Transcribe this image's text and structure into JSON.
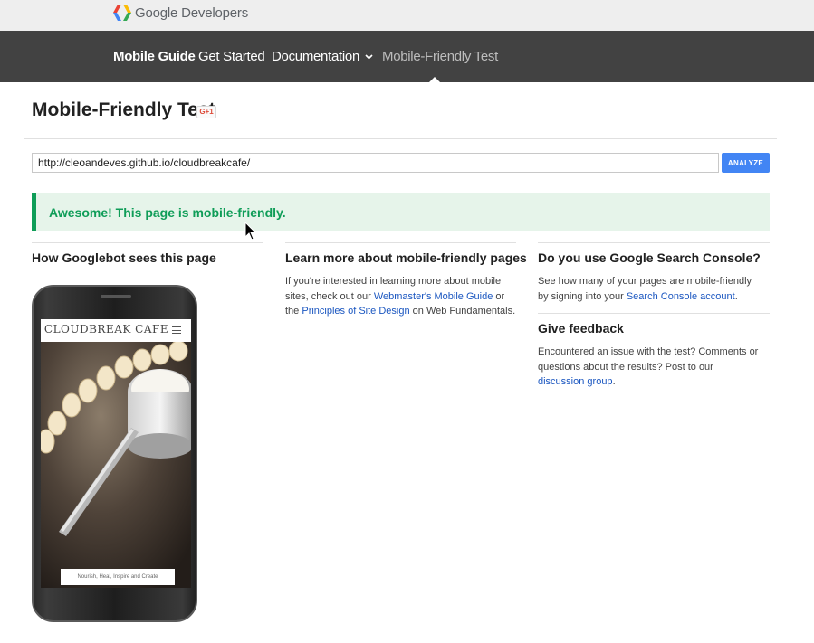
{
  "brand": {
    "name": "Google Developers",
    "icon": "google-developers-logo-icon"
  },
  "nav": {
    "items": [
      {
        "label": "Mobile Guide"
      },
      {
        "label": "Get Started"
      },
      {
        "label": "Documentation"
      },
      {
        "label": "Mobile-Friendly Test"
      }
    ],
    "dropdown_icon": "chevron-down-icon"
  },
  "page": {
    "title": "Mobile-Friendly Test",
    "gplus_label": "G+1"
  },
  "search": {
    "url_value": "http://cleoandeves.github.io/cloudbreakcafe/",
    "analyze_label": "ANALYZE"
  },
  "result": {
    "message": "Awesome! This page is mobile-friendly.",
    "color": "#0f9d58"
  },
  "googlebot": {
    "title": "How Googlebot sees this page",
    "preview": {
      "site_name": "CLOUDBREAK CAFE",
      "tagline": "Nourish, Heal, Inspire and Create"
    }
  },
  "learn": {
    "title": "Learn more about mobile-friendly pages",
    "text1": "If you're interested in learning more about mobile sites, check out our ",
    "link1": "Webmaster's Mobile Guide",
    "text2": " or the ",
    "link2": "Principles of Site Design",
    "text3": " on Web Fundamentals."
  },
  "console": {
    "title": "Do you use Google Search Console?",
    "text1": "See how many of your pages are mobile-friendly by signing into your ",
    "link1": "Search Console account",
    "text2": "."
  },
  "feedback": {
    "title": "Give feedback",
    "text1": "Encountered an issue with the test? Comments or questions about the results? Post to our ",
    "link1": "discussion group",
    "text2": "."
  },
  "colors": {
    "nav_bg": "#424242",
    "accent_blue": "#4285f4",
    "link": "#1a56c0",
    "success": "#0f9d58"
  }
}
